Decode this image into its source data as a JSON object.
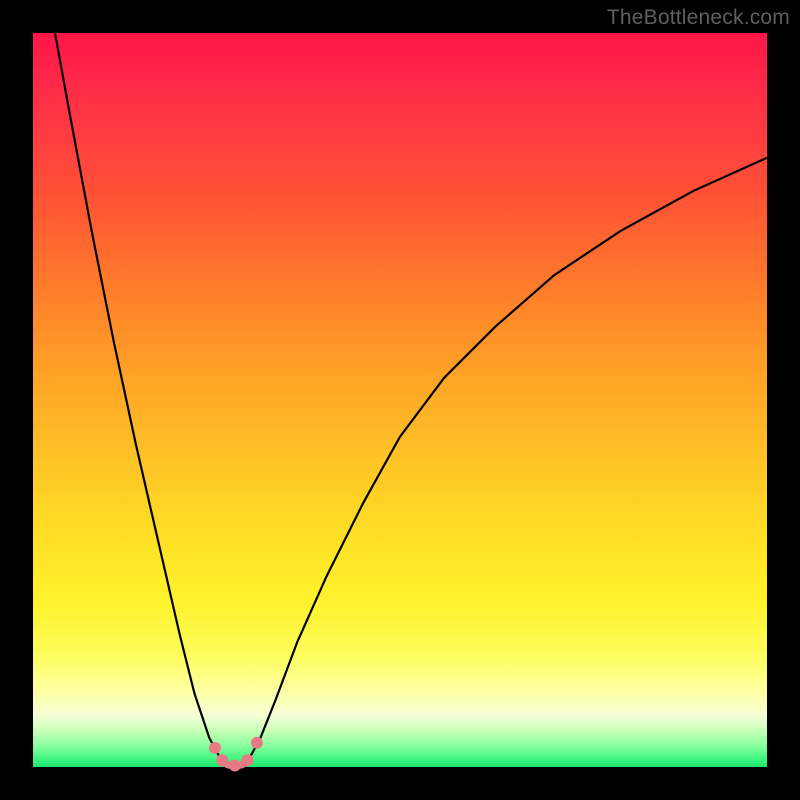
{
  "watermark": "TheBottleneck.com",
  "chart_data": {
    "type": "line",
    "title": "",
    "xlabel": "",
    "ylabel": "",
    "xlim": [
      0,
      100
    ],
    "ylim": [
      0,
      100
    ],
    "grid": false,
    "legend": false,
    "notes": "Two black curves on a rainbow gradient. Left curve: steep drop from top-left into a small trough near x≈27. Right curve: rises from the trough with decreasing slope toward the right edge. Pink dots + short pink segment mark the trough minimum.",
    "series": [
      {
        "name": "left-branch",
        "x": [
          3,
          5,
          8,
          11,
          14,
          17,
          20,
          22,
          24,
          25.5
        ],
        "values": [
          100,
          89,
          73,
          58,
          44,
          31,
          18,
          10,
          4,
          1.2
        ]
      },
      {
        "name": "right-branch",
        "x": [
          29.5,
          31,
          33,
          36,
          40,
          45,
          50,
          56,
          63,
          71,
          80,
          90,
          100
        ],
        "values": [
          1.2,
          4,
          9,
          17,
          26,
          36,
          45,
          53,
          60,
          67,
          73,
          78.5,
          83
        ]
      },
      {
        "name": "trough-segment",
        "x": [
          25.5,
          26.5,
          27.5,
          28.5,
          29.5
        ],
        "values": [
          1.2,
          0.3,
          0.1,
          0.3,
          1.2
        ]
      }
    ],
    "markers": {
      "name": "trough-dots",
      "x": [
        24.8,
        25.8,
        27.5,
        29.2,
        30.5
      ],
      "values": [
        2.6,
        0.9,
        0.2,
        0.9,
        3.3
      ],
      "color": "#e77a84",
      "radius_px": 6
    },
    "gradient_stops": [
      {
        "pct": 0,
        "color": "#ff1548"
      },
      {
        "pct": 22,
        "color": "#ff5136"
      },
      {
        "pct": 46,
        "color": "#ffa126"
      },
      {
        "pct": 70,
        "color": "#ffe326"
      },
      {
        "pct": 90,
        "color": "#fdffa8"
      },
      {
        "pct": 97,
        "color": "#8cffa0"
      },
      {
        "pct": 100,
        "color": "#1de46e"
      }
    ]
  }
}
